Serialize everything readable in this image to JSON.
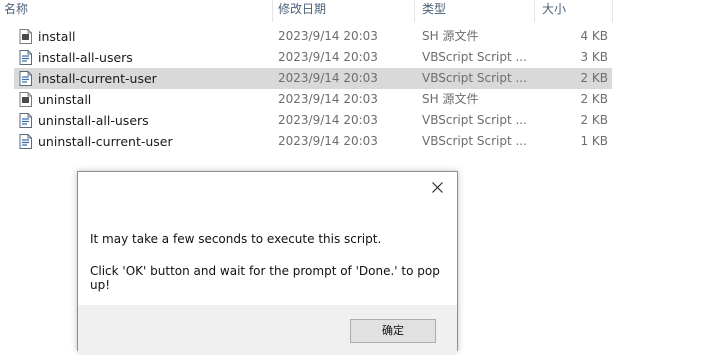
{
  "columns": {
    "name": "名称",
    "date": "修改日期",
    "type": "类型",
    "size": "大小"
  },
  "files": [
    {
      "name": "install",
      "date": "2023/9/14 20:03",
      "type": "SH 源文件",
      "size": "4 KB",
      "icon": "sh-file-icon",
      "selected": false
    },
    {
      "name": "install-all-users",
      "date": "2023/9/14 20:03",
      "type": "VBScript Script ...",
      "size": "3 KB",
      "icon": "vbscript-file-icon",
      "selected": false
    },
    {
      "name": "install-current-user",
      "date": "2023/9/14 20:03",
      "type": "VBScript Script ...",
      "size": "2 KB",
      "icon": "vbscript-file-icon",
      "selected": true
    },
    {
      "name": "uninstall",
      "date": "2023/9/14 20:03",
      "type": "SH 源文件",
      "size": "2 KB",
      "icon": "sh-file-icon",
      "selected": false
    },
    {
      "name": "uninstall-all-users",
      "date": "2023/9/14 20:03",
      "type": "VBScript Script ...",
      "size": "2 KB",
      "icon": "vbscript-file-icon",
      "selected": false
    },
    {
      "name": "uninstall-current-user",
      "date": "2023/9/14 20:03",
      "type": "VBScript Script ...",
      "size": "1 KB",
      "icon": "vbscript-file-icon",
      "selected": false
    }
  ],
  "dialog": {
    "message_line1": "It may take a few seconds to execute this script.",
    "message_line2": "Click 'OK' button and wait for the prompt of 'Done.' to pop up!",
    "ok_label": "确定",
    "close_icon": "close-icon"
  },
  "colors": {
    "selected_row": "#d9d9d9",
    "header_text": "#4c607a",
    "footer_bg": "#f0f0f0"
  }
}
